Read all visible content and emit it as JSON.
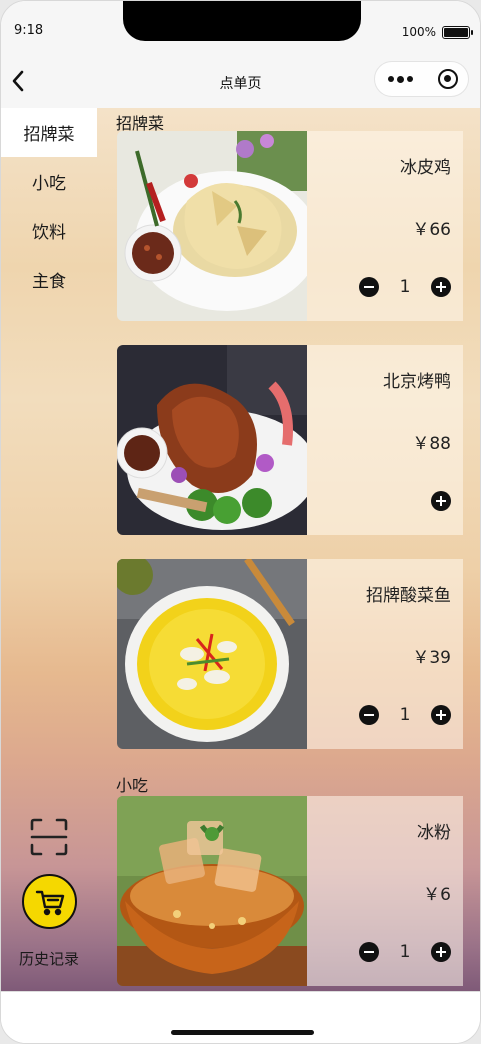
{
  "status_bar": {
    "time": "9:18",
    "battery": "100%"
  },
  "nav": {
    "title": "点单页"
  },
  "sidebar": {
    "items": [
      {
        "label": "招牌菜",
        "active": true
      },
      {
        "label": "小吃",
        "active": false
      },
      {
        "label": "饮料",
        "active": false
      },
      {
        "label": "主食",
        "active": false
      }
    ],
    "history_label": "历史记录"
  },
  "sections": [
    {
      "title": "招牌菜"
    },
    {
      "title": "小吃"
    }
  ],
  "dishes": [
    {
      "name": "冰皮鸡",
      "price": "￥66",
      "quantity": "1",
      "show_stepper": true,
      "image": "poached-chicken"
    },
    {
      "name": "北京烤鸭",
      "price": "￥88",
      "quantity": "",
      "show_stepper": false,
      "image": "roast-duck"
    },
    {
      "name": "招牌酸菜鱼",
      "price": "￥39",
      "quantity": "1",
      "show_stepper": true,
      "image": "pickled-fish"
    },
    {
      "name": "冰粉",
      "price": "￥6",
      "quantity": "1",
      "show_stepper": true,
      "image": "ice-jelly"
    }
  ],
  "colors": {
    "cart_accent": "#f5d800",
    "sidebar_active_bg": "#ffffff"
  }
}
